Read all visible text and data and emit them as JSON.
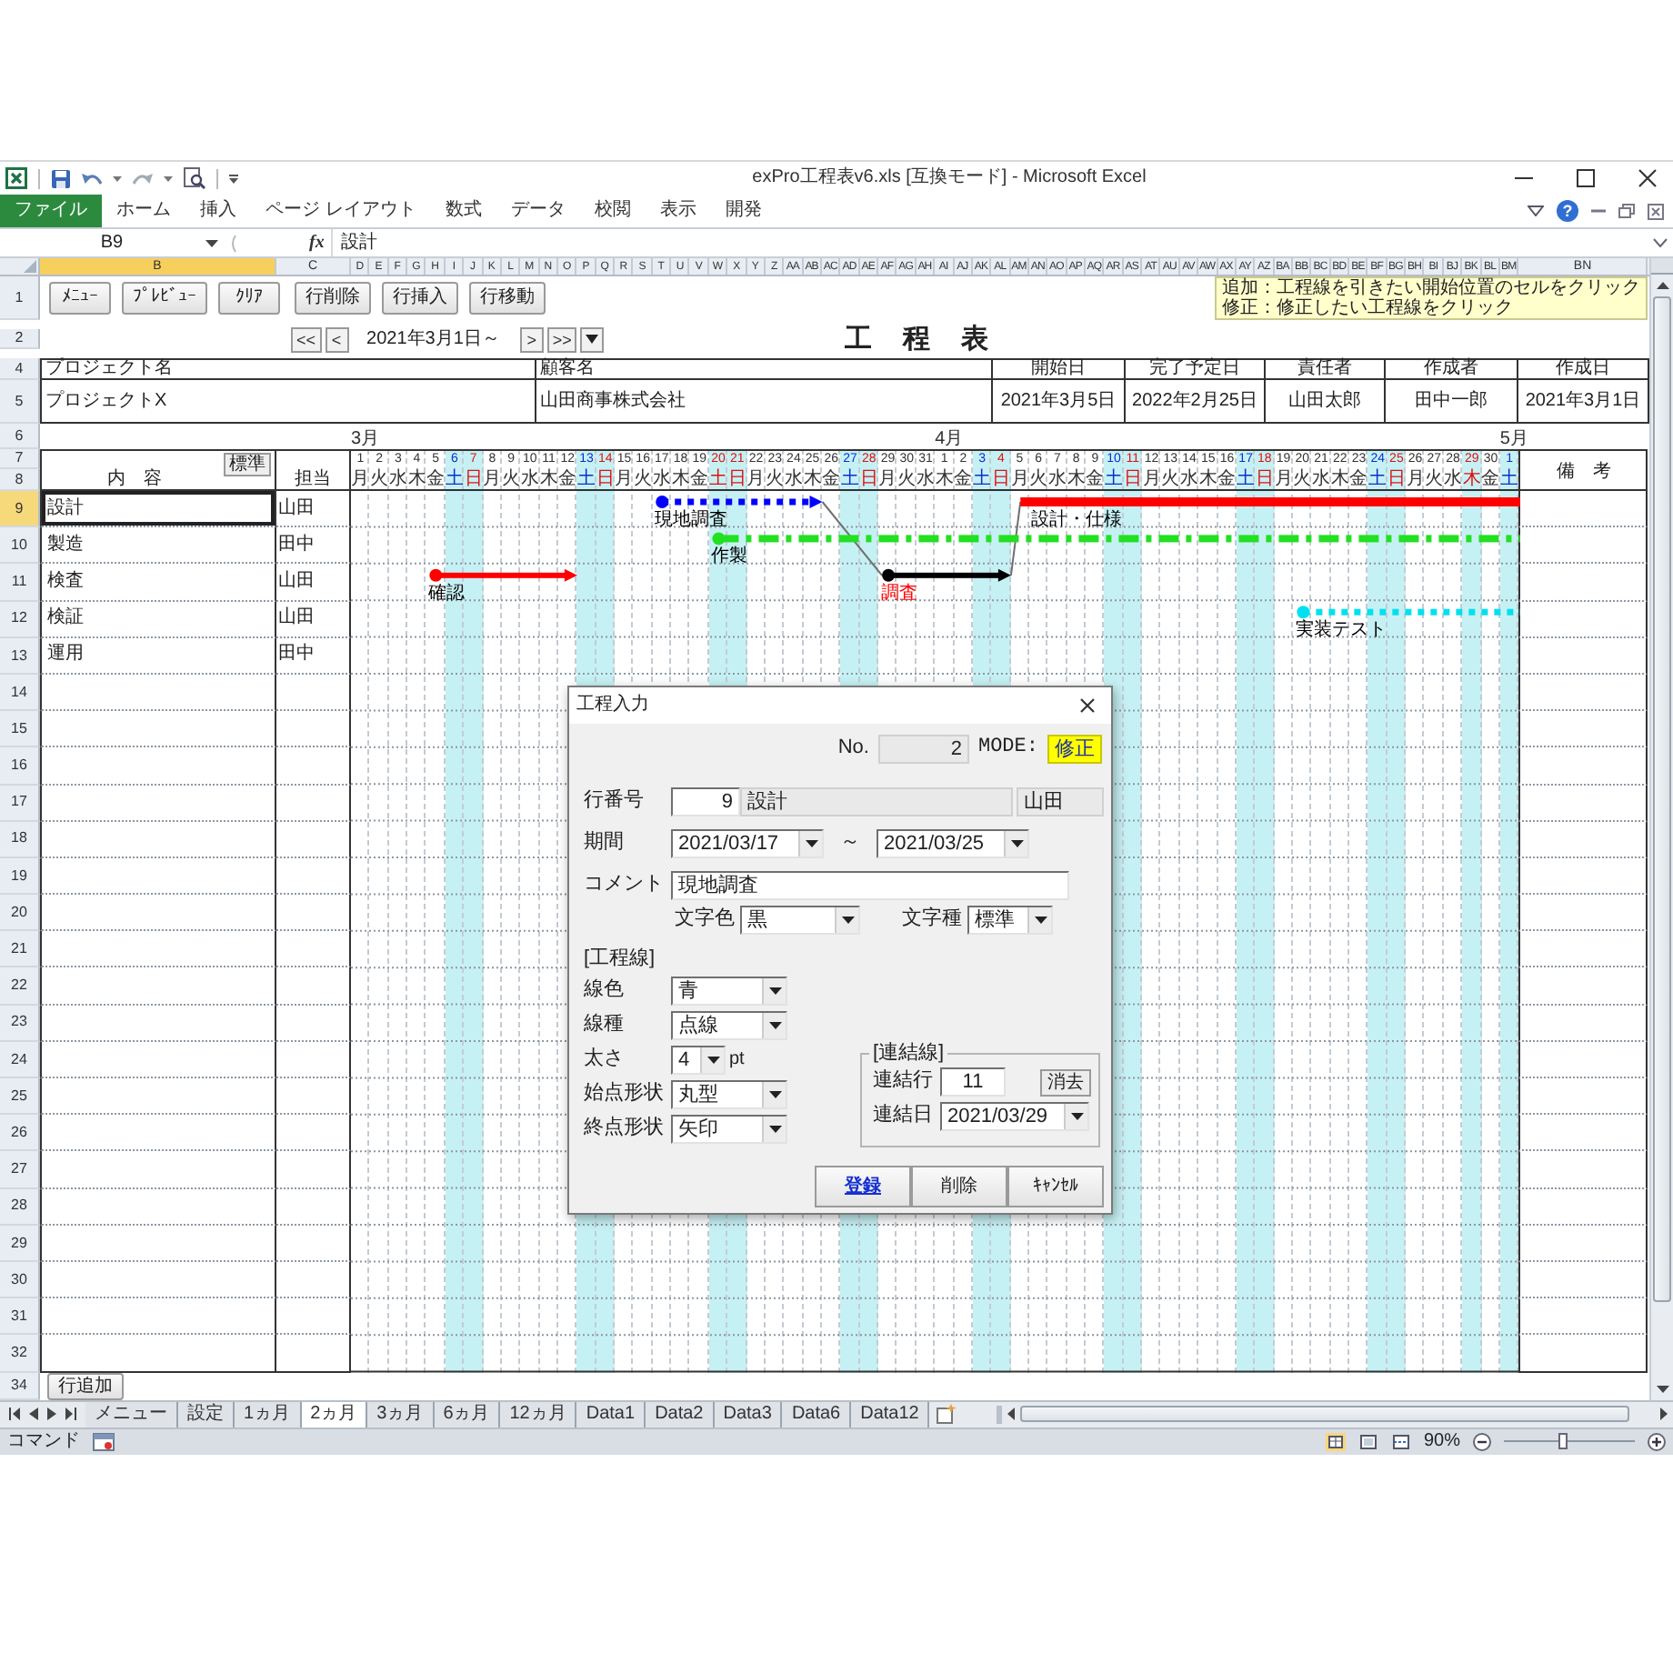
{
  "window": {
    "title": "exPro工程表v6.xls [互換モード] - Microsoft Excel"
  },
  "ribbon": {
    "tabs": [
      {
        "label": "ファイル",
        "kind": "file"
      },
      {
        "label": "ホーム",
        "kind": "tab"
      },
      {
        "label": "挿入",
        "kind": "tab"
      },
      {
        "label": "ページ レイアウト",
        "kind": "tab"
      },
      {
        "label": "数式",
        "kind": "tab"
      },
      {
        "label": "データ",
        "kind": "tab"
      },
      {
        "label": "校閲",
        "kind": "tab"
      },
      {
        "label": "表示",
        "kind": "tab"
      },
      {
        "label": "開発",
        "kind": "tab"
      }
    ],
    "help": "?"
  },
  "formula_bar": {
    "name_box": "B9",
    "fx": "fx",
    "formula": "設計"
  },
  "columns": [
    {
      "label": "B",
      "selected": true
    },
    {
      "label": "C",
      "selected": false
    },
    {
      "label": "D",
      "selected": false
    },
    {
      "label": "E",
      "selected": false
    },
    {
      "label": "F",
      "selected": false
    },
    {
      "label": "G",
      "selected": false
    },
    {
      "label": "H",
      "selected": false
    },
    {
      "label": "I",
      "selected": false
    },
    {
      "label": "J",
      "selected": false
    },
    {
      "label": "K",
      "selected": false
    },
    {
      "label": "L",
      "selected": false
    },
    {
      "label": "M",
      "selected": false
    },
    {
      "label": "N",
      "selected": false
    },
    {
      "label": "O",
      "selected": false
    },
    {
      "label": "P",
      "selected": false
    },
    {
      "label": "Q",
      "selected": false
    },
    {
      "label": "R",
      "selected": false
    },
    {
      "label": "S",
      "selected": false
    },
    {
      "label": "T",
      "selected": false
    },
    {
      "label": "U",
      "selected": false
    },
    {
      "label": "V",
      "selected": false
    },
    {
      "label": "W",
      "selected": false
    },
    {
      "label": "X",
      "selected": false
    },
    {
      "label": "Y",
      "selected": false
    },
    {
      "label": "Z",
      "selected": false
    },
    {
      "label": "AA",
      "selected": false
    },
    {
      "label": "AB",
      "selected": false
    },
    {
      "label": "AC",
      "selected": false
    },
    {
      "label": "AD",
      "selected": false
    },
    {
      "label": "AE",
      "selected": false
    },
    {
      "label": "AF",
      "selected": false
    },
    {
      "label": "AG",
      "selected": false
    },
    {
      "label": "AH",
      "selected": false
    },
    {
      "label": "AI",
      "selected": false
    },
    {
      "label": "AJ",
      "selected": false
    },
    {
      "label": "AK",
      "selected": false
    },
    {
      "label": "AL",
      "selected": false
    },
    {
      "label": "AM",
      "selected": false
    },
    {
      "label": "AN",
      "selected": false
    },
    {
      "label": "AO",
      "selected": false
    },
    {
      "label": "AP",
      "selected": false
    },
    {
      "label": "AQ",
      "selected": false
    },
    {
      "label": "AR",
      "selected": false
    },
    {
      "label": "AS",
      "selected": false
    },
    {
      "label": "AT",
      "selected": false
    },
    {
      "label": "AU",
      "selected": false
    },
    {
      "label": "AV",
      "selected": false
    },
    {
      "label": "AW",
      "selected": false
    },
    {
      "label": "AX",
      "selected": false
    },
    {
      "label": "AY",
      "selected": false
    },
    {
      "label": "AZ",
      "selected": false
    },
    {
      "label": "BA",
      "selected": false
    },
    {
      "label": "BB",
      "selected": false
    },
    {
      "label": "BC",
      "selected": false
    },
    {
      "label": "BD",
      "selected": false
    },
    {
      "label": "BE",
      "selected": false
    },
    {
      "label": "BF",
      "selected": false
    },
    {
      "label": "BG",
      "selected": false
    },
    {
      "label": "BH",
      "selected": false
    },
    {
      "label": "BI",
      "selected": false
    },
    {
      "label": "BJ",
      "selected": false
    },
    {
      "label": "BK",
      "selected": false
    },
    {
      "label": "BL",
      "selected": false
    },
    {
      "label": "BM",
      "selected": false
    },
    {
      "label": "BN",
      "selected": false
    }
  ],
  "toolbar": {
    "row_header": "1",
    "buttons": [
      "ﾒﾆｭｰ",
      "ﾌﾟﾚﾋﾞｭｰ",
      "ｸﾘｱ"
    ],
    "row_buttons": [
      "行削除",
      "行挿入",
      "行移動"
    ]
  },
  "notice": [
    "追加：工程線を引きたい開始位置のセルをクリック",
    "修正：修正したい工程線をクリック"
  ],
  "date_nav": {
    "row_header": "2",
    "back": [
      "<<",
      "<"
    ],
    "label": "2021年3月1日～",
    "forward": [
      ">",
      ">>"
    ]
  },
  "sheet_title": "工　程　表",
  "project": {
    "row_headers": [
      "4",
      "5"
    ],
    "fields": [
      {
        "header": "プロジェクト名",
        "value": "プロジェクトX"
      },
      {
        "header": "顧客名",
        "value": "山田商事株式会社"
      },
      {
        "header": "開始日",
        "value": "2021年3月5日"
      },
      {
        "header": "完了予定日",
        "value": "2022年2月25日"
      },
      {
        "header": "責任者",
        "value": "山田太郎"
      },
      {
        "header": "作成者",
        "value": "田中一郎"
      },
      {
        "header": "作成日",
        "value": "2021年3月1日"
      }
    ]
  },
  "calendar": {
    "month_row_header": "6",
    "day_row_headers": [
      "7",
      "8"
    ],
    "days": [
      {
        "day": "1",
        "weekday": "月",
        "kind": "weekday",
        "month": "3月"
      },
      {
        "day": "2",
        "weekday": "火",
        "kind": "weekday"
      },
      {
        "day": "3",
        "weekday": "水",
        "kind": "weekday"
      },
      {
        "day": "4",
        "weekday": "木",
        "kind": "weekday"
      },
      {
        "day": "5",
        "weekday": "金",
        "kind": "weekday"
      },
      {
        "day": "6",
        "weekday": "土",
        "kind": "saturday"
      },
      {
        "day": "7",
        "weekday": "日",
        "kind": "sunday"
      },
      {
        "day": "8",
        "weekday": "月",
        "kind": "weekday"
      },
      {
        "day": "9",
        "weekday": "火",
        "kind": "weekday"
      },
      {
        "day": "10",
        "weekday": "水",
        "kind": "weekday"
      },
      {
        "day": "11",
        "weekday": "木",
        "kind": "weekday"
      },
      {
        "day": "12",
        "weekday": "金",
        "kind": "weekday"
      },
      {
        "day": "13",
        "weekday": "土",
        "kind": "saturday"
      },
      {
        "day": "14",
        "weekday": "日",
        "kind": "sunday"
      },
      {
        "day": "15",
        "weekday": "月",
        "kind": "weekday"
      },
      {
        "day": "16",
        "weekday": "火",
        "kind": "weekday"
      },
      {
        "day": "17",
        "weekday": "水",
        "kind": "weekday"
      },
      {
        "day": "18",
        "weekday": "木",
        "kind": "weekday"
      },
      {
        "day": "19",
        "weekday": "金",
        "kind": "weekday"
      },
      {
        "day": "20",
        "weekday": "土",
        "kind": "holiday"
      },
      {
        "day": "21",
        "weekday": "日",
        "kind": "sunday"
      },
      {
        "day": "22",
        "weekday": "月",
        "kind": "weekday"
      },
      {
        "day": "23",
        "weekday": "火",
        "kind": "weekday"
      },
      {
        "day": "24",
        "weekday": "水",
        "kind": "weekday"
      },
      {
        "day": "25",
        "weekday": "木",
        "kind": "weekday"
      },
      {
        "day": "26",
        "weekday": "金",
        "kind": "weekday"
      },
      {
        "day": "27",
        "weekday": "土",
        "kind": "saturday"
      },
      {
        "day": "28",
        "weekday": "日",
        "kind": "sunday"
      },
      {
        "day": "29",
        "weekday": "月",
        "kind": "weekday"
      },
      {
        "day": "30",
        "weekday": "火",
        "kind": "weekday"
      },
      {
        "day": "31",
        "weekday": "水",
        "kind": "weekday"
      },
      {
        "day": "1",
        "weekday": "木",
        "kind": "weekday",
        "month": "4月"
      },
      {
        "day": "2",
        "weekday": "金",
        "kind": "weekday"
      },
      {
        "day": "3",
        "weekday": "土",
        "kind": "saturday"
      },
      {
        "day": "4",
        "weekday": "日",
        "kind": "sunday"
      },
      {
        "day": "5",
        "weekday": "月",
        "kind": "weekday"
      },
      {
        "day": "6",
        "weekday": "火",
        "kind": "weekday"
      },
      {
        "day": "7",
        "weekday": "水",
        "kind": "weekday"
      },
      {
        "day": "8",
        "weekday": "木",
        "kind": "weekday"
      },
      {
        "day": "9",
        "weekday": "金",
        "kind": "weekday"
      },
      {
        "day": "10",
        "weekday": "土",
        "kind": "saturday"
      },
      {
        "day": "11",
        "weekday": "日",
        "kind": "sunday"
      },
      {
        "day": "12",
        "weekday": "月",
        "kind": "weekday"
      },
      {
        "day": "13",
        "weekday": "火",
        "kind": "weekday"
      },
      {
        "day": "14",
        "weekday": "水",
        "kind": "weekday"
      },
      {
        "day": "15",
        "weekday": "木",
        "kind": "weekday"
      },
      {
        "day": "16",
        "weekday": "金",
        "kind": "weekday"
      },
      {
        "day": "17",
        "weekday": "土",
        "kind": "saturday"
      },
      {
        "day": "18",
        "weekday": "日",
        "kind": "sunday"
      },
      {
        "day": "19",
        "weekday": "月",
        "kind": "weekday"
      },
      {
        "day": "20",
        "weekday": "火",
        "kind": "weekday"
      },
      {
        "day": "21",
        "weekday": "水",
        "kind": "weekday"
      },
      {
        "day": "22",
        "weekday": "木",
        "kind": "weekday"
      },
      {
        "day": "23",
        "weekday": "金",
        "kind": "weekday"
      },
      {
        "day": "24",
        "weekday": "土",
        "kind": "saturday"
      },
      {
        "day": "25",
        "weekday": "日",
        "kind": "sunday"
      },
      {
        "day": "26",
        "weekday": "月",
        "kind": "weekday"
      },
      {
        "day": "27",
        "weekday": "火",
        "kind": "weekday"
      },
      {
        "day": "28",
        "weekday": "水",
        "kind": "weekday"
      },
      {
        "day": "29",
        "weekday": "木",
        "kind": "holiday"
      },
      {
        "day": "30",
        "weekday": "金",
        "kind": "weekday"
      },
      {
        "day": "1",
        "weekday": "土",
        "kind": "saturday",
        "month": "5月"
      }
    ]
  },
  "table_headers": {
    "content": "内　容",
    "content_button": "標準",
    "owner": "担当",
    "remarks": "備　考"
  },
  "tasks": [
    {
      "row_header": "9",
      "content": "設計",
      "owner": "山田",
      "selected": true,
      "cells": [
        {
          "kind": "empty"
        },
        {
          "kind": "empty"
        },
        {
          "kind": "empty"
        },
        {
          "kind": "empty"
        },
        {
          "kind": "empty"
        },
        {
          "kind": "empty"
        },
        {
          "kind": "empty"
        },
        {
          "kind": "empty"
        },
        {
          "kind": "empty"
        },
        {
          "kind": "empty"
        },
        {
          "kind": "empty"
        },
        {
          "kind": "empty"
        },
        {
          "kind": "empty"
        },
        {
          "kind": "empty"
        },
        {
          "kind": "empty"
        },
        {
          "kind": "empty"
        },
        {
          "kind": "dotted",
          "color": "#0000ff",
          "thick": false,
          "start_circle": true,
          "label": {
            "text": "現地調査",
            "color": "#000000"
          }
        },
        {
          "kind": "dotted"
        },
        {
          "kind": "dotted"
        },
        {
          "kind": "dotted"
        },
        {
          "kind": "dotted"
        },
        {
          "kind": "dotted"
        },
        {
          "kind": "dotted"
        },
        {
          "kind": "dotted"
        },
        {
          "kind": "dotted",
          "end_arrow": true,
          "link_out": true
        },
        {
          "kind": "empty"
        },
        {
          "kind": "empty"
        },
        {
          "kind": "empty"
        },
        {
          "kind": "empty"
        },
        {
          "kind": "empty"
        },
        {
          "kind": "empty"
        },
        {
          "kind": "empty"
        },
        {
          "kind": "empty"
        },
        {
          "kind": "empty"
        },
        {
          "kind": "empty"
        },
        {
          "kind": "solid",
          "color": "#ff0000",
          "thick": true,
          "start_circle": false,
          "link_in": true,
          "label": {
            "text": "設計・仕様",
            "color": "#000000"
          }
        },
        {
          "kind": "solid"
        },
        {
          "kind": "solid"
        },
        {
          "kind": "solid"
        },
        {
          "kind": "solid"
        },
        {
          "kind": "solid"
        },
        {
          "kind": "solid"
        },
        {
          "kind": "solid"
        },
        {
          "kind": "solid"
        },
        {
          "kind": "solid"
        },
        {
          "kind": "solid"
        },
        {
          "kind": "solid"
        },
        {
          "kind": "solid"
        },
        {
          "kind": "solid"
        },
        {
          "kind": "solid"
        },
        {
          "kind": "solid"
        },
        {
          "kind": "solid"
        },
        {
          "kind": "solid"
        },
        {
          "kind": "solid"
        },
        {
          "kind": "solid"
        },
        {
          "kind": "solid"
        },
        {
          "kind": "solid"
        },
        {
          "kind": "solid"
        },
        {
          "kind": "solid"
        },
        {
          "kind": "solid"
        },
        {
          "kind": "solid"
        },
        {
          "kind": "solid",
          "end_arrow": false
        }
      ]
    },
    {
      "row_header": "10",
      "content": "製造",
      "owner": "田中",
      "selected": false,
      "cells": [
        {
          "kind": "empty"
        },
        {
          "kind": "empty"
        },
        {
          "kind": "empty"
        },
        {
          "kind": "empty"
        },
        {
          "kind": "empty"
        },
        {
          "kind": "empty"
        },
        {
          "kind": "empty"
        },
        {
          "kind": "empty"
        },
        {
          "kind": "empty"
        },
        {
          "kind": "empty"
        },
        {
          "kind": "empty"
        },
        {
          "kind": "empty"
        },
        {
          "kind": "empty"
        },
        {
          "kind": "empty"
        },
        {
          "kind": "empty"
        },
        {
          "kind": "empty"
        },
        {
          "kind": "empty"
        },
        {
          "kind": "empty"
        },
        {
          "kind": "empty"
        },
        {
          "kind": "dashdot",
          "color": "#22e022",
          "thick": false,
          "start_circle": true,
          "label": {
            "text": "作製",
            "color": "#000000"
          }
        },
        {
          "kind": "dashdot"
        },
        {
          "kind": "dashdot"
        },
        {
          "kind": "dashdot"
        },
        {
          "kind": "dashdot"
        },
        {
          "kind": "dashdot"
        },
        {
          "kind": "dashdot"
        },
        {
          "kind": "dashdot"
        },
        {
          "kind": "dashdot"
        },
        {
          "kind": "dashdot"
        },
        {
          "kind": "dashdot"
        },
        {
          "kind": "dashdot"
        },
        {
          "kind": "dashdot"
        },
        {
          "kind": "dashdot"
        },
        {
          "kind": "dashdot"
        },
        {
          "kind": "dashdot"
        },
        {
          "kind": "dashdot"
        },
        {
          "kind": "dashdot"
        },
        {
          "kind": "dashdot"
        },
        {
          "kind": "dashdot"
        },
        {
          "kind": "dashdot"
        },
        {
          "kind": "dashdot"
        },
        {
          "kind": "dashdot"
        },
        {
          "kind": "dashdot"
        },
        {
          "kind": "dashdot"
        },
        {
          "kind": "dashdot"
        },
        {
          "kind": "dashdot"
        },
        {
          "kind": "dashdot"
        },
        {
          "kind": "dashdot"
        },
        {
          "kind": "dashdot"
        },
        {
          "kind": "dashdot"
        },
        {
          "kind": "dashdot"
        },
        {
          "kind": "dashdot"
        },
        {
          "kind": "dashdot"
        },
        {
          "kind": "dashdot"
        },
        {
          "kind": "dashdot"
        },
        {
          "kind": "dashdot"
        },
        {
          "kind": "dashdot"
        },
        {
          "kind": "dashdot"
        },
        {
          "kind": "dashdot"
        },
        {
          "kind": "dashdot"
        },
        {
          "kind": "dashdot"
        },
        {
          "kind": "dashdot",
          "end_arrow": false
        }
      ]
    },
    {
      "row_header": "11",
      "content": "検査",
      "owner": "山田",
      "selected": false,
      "cells": [
        {
          "kind": "empty"
        },
        {
          "kind": "empty"
        },
        {
          "kind": "empty"
        },
        {
          "kind": "empty"
        },
        {
          "kind": "solid",
          "color": "#ff0000",
          "thick": false,
          "start_circle": true,
          "label": {
            "text": "確認",
            "color": "#000000"
          }
        },
        {
          "kind": "solid"
        },
        {
          "kind": "solid"
        },
        {
          "kind": "solid"
        },
        {
          "kind": "solid"
        },
        {
          "kind": "solid"
        },
        {
          "kind": "solid"
        },
        {
          "kind": "solid",
          "end_arrow": true
        },
        {
          "kind": "empty"
        },
        {
          "kind": "empty"
        },
        {
          "kind": "empty"
        },
        {
          "kind": "empty"
        },
        {
          "kind": "empty"
        },
        {
          "kind": "empty"
        },
        {
          "kind": "empty"
        },
        {
          "kind": "empty"
        },
        {
          "kind": "empty"
        },
        {
          "kind": "empty"
        },
        {
          "kind": "empty"
        },
        {
          "kind": "empty"
        },
        {
          "kind": "empty"
        },
        {
          "kind": "empty"
        },
        {
          "kind": "empty"
        },
        {
          "kind": "empty"
        },
        {
          "kind": "solid",
          "color": "#000000",
          "thick": false,
          "start_circle": true,
          "link_in": true,
          "label": {
            "text": "調査",
            "color": "#ff0000"
          }
        },
        {
          "kind": "solid"
        },
        {
          "kind": "solid"
        },
        {
          "kind": "solid"
        },
        {
          "kind": "solid"
        },
        {
          "kind": "solid"
        },
        {
          "kind": "solid",
          "end_arrow": true,
          "link_out": true
        },
        {
          "kind": "empty"
        },
        {
          "kind": "empty"
        },
        {
          "kind": "empty"
        },
        {
          "kind": "empty"
        },
        {
          "kind": "empty"
        },
        {
          "kind": "empty"
        },
        {
          "kind": "empty"
        },
        {
          "kind": "empty"
        },
        {
          "kind": "empty"
        },
        {
          "kind": "empty"
        },
        {
          "kind": "empty"
        },
        {
          "kind": "empty"
        },
        {
          "kind": "empty"
        },
        {
          "kind": "empty"
        },
        {
          "kind": "empty"
        },
        {
          "kind": "empty"
        },
        {
          "kind": "empty"
        },
        {
          "kind": "empty"
        },
        {
          "kind": "empty"
        },
        {
          "kind": "empty"
        },
        {
          "kind": "empty"
        },
        {
          "kind": "empty"
        },
        {
          "kind": "empty"
        },
        {
          "kind": "empty"
        },
        {
          "kind": "empty"
        },
        {
          "kind": "empty"
        },
        {
          "kind": "empty"
        }
      ]
    },
    {
      "row_header": "12",
      "content": "検証",
      "owner": "山田",
      "selected": false,
      "cells": [
        {
          "kind": "empty"
        },
        {
          "kind": "empty"
        },
        {
          "kind": "empty"
        },
        {
          "kind": "empty"
        },
        {
          "kind": "empty"
        },
        {
          "kind": "empty"
        },
        {
          "kind": "empty"
        },
        {
          "kind": "empty"
        },
        {
          "kind": "empty"
        },
        {
          "kind": "empty"
        },
        {
          "kind": "empty"
        },
        {
          "kind": "empty"
        },
        {
          "kind": "empty"
        },
        {
          "kind": "empty"
        },
        {
          "kind": "empty"
        },
        {
          "kind": "empty"
        },
        {
          "kind": "empty"
        },
        {
          "kind": "empty"
        },
        {
          "kind": "empty"
        },
        {
          "kind": "empty"
        },
        {
          "kind": "empty"
        },
        {
          "kind": "empty"
        },
        {
          "kind": "empty"
        },
        {
          "kind": "empty"
        },
        {
          "kind": "empty"
        },
        {
          "kind": "empty"
        },
        {
          "kind": "empty"
        },
        {
          "kind": "empty"
        },
        {
          "kind": "empty"
        },
        {
          "kind": "empty"
        },
        {
          "kind": "empty"
        },
        {
          "kind": "empty"
        },
        {
          "kind": "empty"
        },
        {
          "kind": "empty"
        },
        {
          "kind": "empty"
        },
        {
          "kind": "empty"
        },
        {
          "kind": "empty"
        },
        {
          "kind": "empty"
        },
        {
          "kind": "empty"
        },
        {
          "kind": "empty"
        },
        {
          "kind": "empty"
        },
        {
          "kind": "empty"
        },
        {
          "kind": "empty"
        },
        {
          "kind": "empty"
        },
        {
          "kind": "empty"
        },
        {
          "kind": "empty"
        },
        {
          "kind": "empty"
        },
        {
          "kind": "empty"
        },
        {
          "kind": "empty"
        },
        {
          "kind": "empty"
        },
        {
          "kind": "dotted",
          "color": "#00e0f0",
          "thick": false,
          "start_circle": true,
          "label": {
            "text": "実装テスト",
            "color": "#000000"
          }
        },
        {
          "kind": "dotted"
        },
        {
          "kind": "dotted"
        },
        {
          "kind": "dotted"
        },
        {
          "kind": "dotted"
        },
        {
          "kind": "dotted"
        },
        {
          "kind": "dotted"
        },
        {
          "kind": "dotted"
        },
        {
          "kind": "dotted"
        },
        {
          "kind": "dotted"
        },
        {
          "kind": "dotted"
        },
        {
          "kind": "dotted",
          "end_arrow": false
        }
      ]
    },
    {
      "row_header": "13",
      "content": "運用",
      "owner": "田中",
      "selected": false
    }
  ],
  "blank_row_headers": [
    "14",
    "15",
    "16",
    "17",
    "18",
    "19",
    "20",
    "21",
    "22",
    "23",
    "24",
    "25",
    "26",
    "27",
    "28",
    "29",
    "30",
    "31",
    "32"
  ],
  "add_row": {
    "row_header": "34",
    "button": "行追加"
  },
  "sheet_tabs": [
    {
      "label": "メニュー",
      "selected": false
    },
    {
      "label": "設定",
      "selected": false
    },
    {
      "label": "1ヵ月",
      "selected": false
    },
    {
      "label": "2ヵ月",
      "selected": true
    },
    {
      "label": "3ヵ月",
      "selected": false
    },
    {
      "label": "6ヵ月",
      "selected": false
    },
    {
      "label": "12ヵ月",
      "selected": false
    },
    {
      "label": "Data1",
      "selected": false
    },
    {
      "label": "Data2",
      "selected": false
    },
    {
      "label": "Data3",
      "selected": false
    },
    {
      "label": "Data6",
      "selected": false
    },
    {
      "label": "Data12",
      "selected": false
    }
  ],
  "status_bar": {
    "mode": "コマンド",
    "zoom": "90%",
    "zoom_slider": {
      "level": 0.46
    }
  },
  "dialog": {
    "title": "工程入力",
    "number_label": "No.",
    "number": "2",
    "mode_label": "MODE:",
    "mode": "修正",
    "line_field": {
      "label": "行番号",
      "value": "9",
      "content": "設計",
      "owner": "山田"
    },
    "period_label": "期間",
    "period_start": "2021/03/17",
    "period_separator": "～",
    "period_end": "2021/03/25",
    "comment_label": "コメント",
    "comment": "現地調査",
    "text_color_label": "文字色",
    "text_color": "黒",
    "text_style_label": "文字種",
    "text_style": "標準",
    "line_section": "[工程線]",
    "line_fields": [
      {
        "kind": "select",
        "label": "線色",
        "value": "青"
      },
      {
        "kind": "select",
        "label": "線種",
        "value": "点線"
      },
      {
        "kind": "size",
        "label": "太さ",
        "value": "4",
        "unit": "pt"
      },
      {
        "kind": "select",
        "label": "始点形状",
        "value": "丸型"
      },
      {
        "kind": "select",
        "label": "終点形状",
        "value": "矢印"
      }
    ],
    "link_group": {
      "title": "[連結線]",
      "target_label": "連結行",
      "target_value": "11",
      "clear_button": "消去",
      "date_label": "連結日",
      "date": "2021/03/29"
    },
    "buttons": [
      {
        "label": "登録",
        "default": true
      },
      {
        "label": "削除",
        "default": false
      },
      {
        "label": "ｷｬﾝｾﾙ",
        "default": false
      }
    ]
  }
}
